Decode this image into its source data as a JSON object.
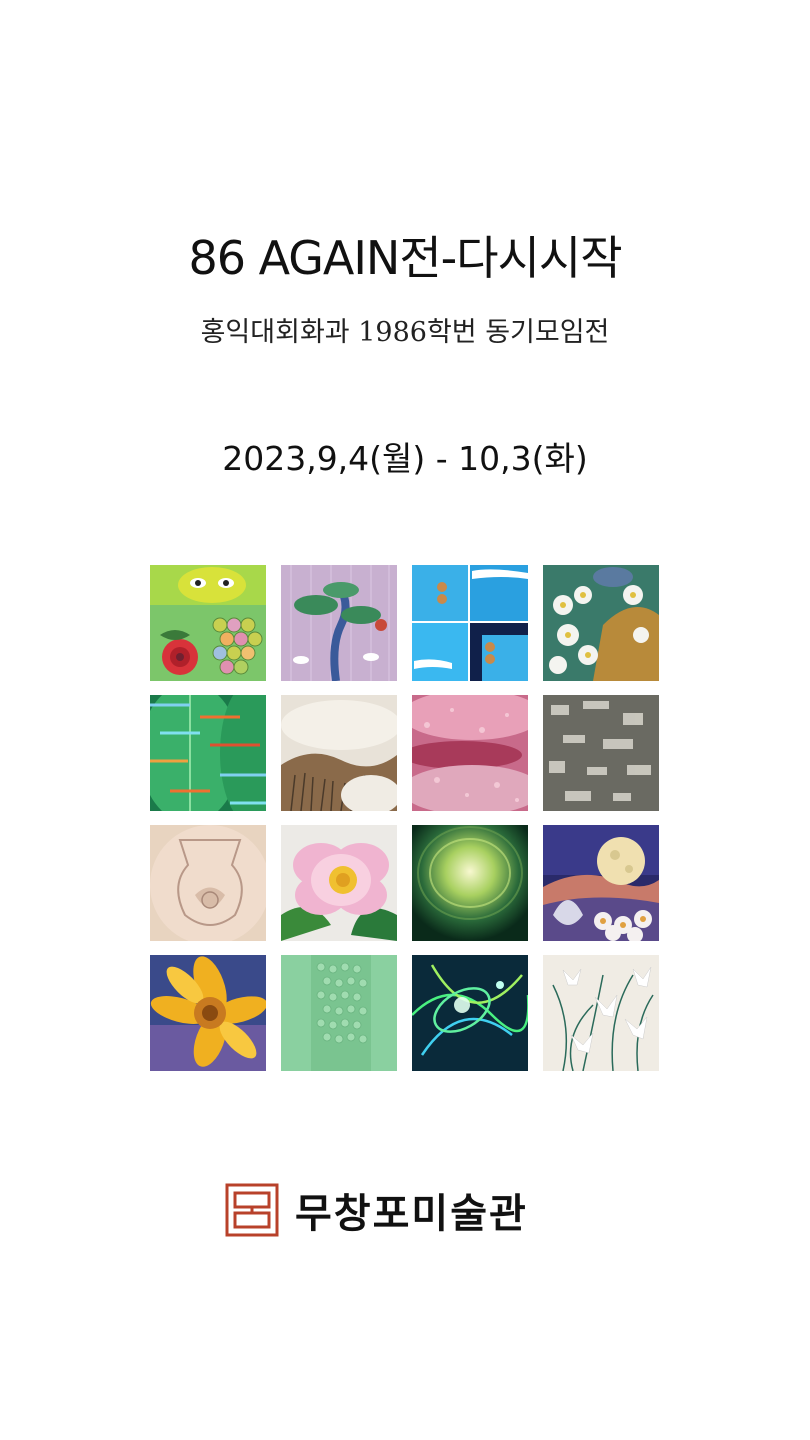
{
  "poster": {
    "title": "86 AGAIN전-다시시작",
    "subtitle_prefix": "홍익대회화과 ",
    "subtitle_year": "1986",
    "subtitle_suffix": "학번 동기모임전",
    "dates": "2023,9,4(월) - 10,3(화)"
  },
  "artworks": [
    {
      "name": "artwork-owl-peony"
    },
    {
      "name": "artwork-pine-cranes"
    },
    {
      "name": "artwork-blue-panels"
    },
    {
      "name": "artwork-white-flowers"
    },
    {
      "name": "artwork-green-leaf-stripes"
    },
    {
      "name": "artwork-snowy-field"
    },
    {
      "name": "artwork-pink-texture"
    },
    {
      "name": "artwork-gray-texture"
    },
    {
      "name": "artwork-relief-vessel"
    },
    {
      "name": "artwork-pink-peony"
    },
    {
      "name": "artwork-green-vortex"
    },
    {
      "name": "artwork-moon-flowers"
    },
    {
      "name": "artwork-sunflower"
    },
    {
      "name": "artwork-green-relief"
    },
    {
      "name": "artwork-neon-lights"
    },
    {
      "name": "artwork-white-lilies"
    }
  ],
  "venue": {
    "name": "무창포미술관",
    "logo_color": "#b8412a"
  }
}
